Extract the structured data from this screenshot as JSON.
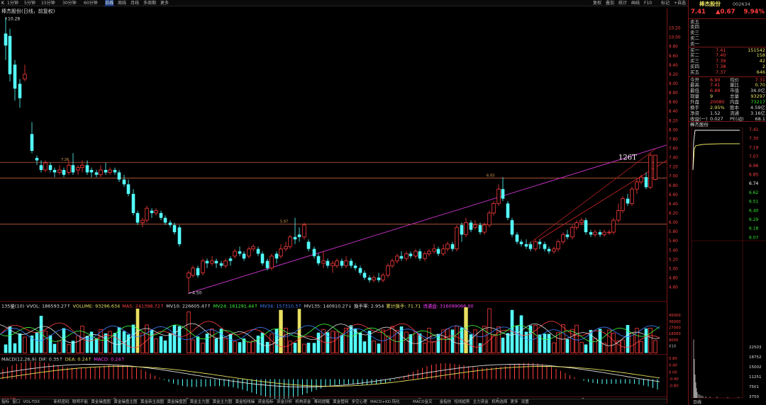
{
  "window": {
    "logo": "K"
  },
  "toolbar": {
    "periods": [
      "1分钟",
      "5分钟",
      "15分钟",
      "30分钟",
      "60分钟",
      "日线",
      "周线",
      "月线",
      "多周期",
      "更多"
    ],
    "active_period": "日线",
    "right_tools": [
      "复权",
      "叠加",
      "统计",
      "画线",
      "F10",
      "标记",
      "+自选",
      "返回"
    ]
  },
  "chart": {
    "title": "棒杰股份(日线，前复权)",
    "high_marker": "↑10.28",
    "low_marker": "←4.50",
    "annotation_126t": "126T",
    "level_labels": [
      "7.26",
      "6.93",
      "5.97"
    ],
    "y_labels": [
      "10.20",
      "10.00",
      "9.80",
      "9.60",
      "9.40",
      "9.20",
      "9.00",
      "8.80",
      "8.60",
      "8.40",
      "8.20",
      "8.00",
      "7.80",
      "7.60",
      "7.40",
      "7.20",
      "7.00",
      "6.80",
      "6.60",
      "6.40",
      "6.20",
      "6.00",
      "5.80",
      "5.60",
      "5.40",
      "5.20",
      "5.00",
      "4.80",
      "4.60"
    ],
    "x_labels": [
      "2019年",
      "2",
      "3",
      "4",
      "5",
      "6",
      "7"
    ],
    "vol_axis": [
      "45000",
      "36000",
      "27000",
      "18000",
      "9000",
      "X10"
    ],
    "macd_axis": [
      "0.80",
      "0.40",
      "0.00",
      "-0.40",
      "-0.80"
    ],
    "indicator_line": [
      {
        "text": "135量(10)",
        "color": "#dddddd"
      },
      {
        "text": "VVOL: 186593.27↑",
        "color": "#dddddd"
      },
      {
        "text": "VOLUME: 93296.634",
        "color": "#e8e060"
      },
      {
        "text": "MA5: 241398.72↑",
        "color": "#ff4040"
      },
      {
        "text": "MV10: 226605.47↑",
        "color": "#dddddd"
      },
      {
        "text": "MV24: 161291.44↑",
        "color": "#40ff40"
      },
      {
        "text": "MV34: 157310.3↑",
        "color": "#4080ff"
      },
      {
        "text": "MV135: 140910.27↓",
        "color": "#dddddd"
      },
      {
        "text": "换手率: 2.954",
        "color": "#dddddd"
      },
      {
        "text": "累计换手: 71.71",
        "color": "#e8e060"
      },
      {
        "text": "流通盘: 316099066.00",
        "color": "#ff40ff"
      }
    ],
    "macd_line": [
      {
        "text": "MACD(12,26,9)",
        "color": "#dddddd"
      },
      {
        "text": "DIF: 0.35↑",
        "color": "#dddddd"
      },
      {
        "text": "DEA: 0.24↑",
        "color": "#e8e060"
      },
      {
        "text": "MACD: 0.24↑",
        "color": "#ff40ff"
      }
    ]
  },
  "quote": {
    "name": "棒杰股份",
    "code": "002634",
    "price": "7.41",
    "change": "▲0.67",
    "pct": "9.94%",
    "asks": [
      {
        "label": "卖五",
        "price": "",
        "vol": ""
      },
      {
        "label": "卖四",
        "price": "",
        "vol": ""
      },
      {
        "label": "卖三",
        "price": "",
        "vol": ""
      },
      {
        "label": "卖二",
        "price": "",
        "vol": ""
      },
      {
        "label": "卖一",
        "price": "",
        "vol": ""
      }
    ],
    "bids": [
      {
        "label": "买一",
        "price": "7.41",
        "vol": "151542"
      },
      {
        "label": "买二",
        "price": "7.40",
        "vol": "158"
      },
      {
        "label": "买三",
        "price": "7.39",
        "vol": "42"
      },
      {
        "label": "买四",
        "price": "7.38",
        "vol": "2"
      },
      {
        "label": "买五",
        "price": "7.37",
        "vol": "646"
      }
    ],
    "stats": [
      {
        "l1": "今开",
        "v1": "6.90",
        "c1": "red",
        "l2": "均价",
        "v2": "7.31",
        "c2": "red"
      },
      {
        "l1": "最高",
        "v1": "7.41",
        "c1": "red",
        "l2": "量比",
        "v2": "0.70",
        "c2": "yel"
      },
      {
        "l1": "最低",
        "v1": "6.88",
        "c1": "red",
        "l2": "市值",
        "v2": "34.0亿",
        "c2": "wht"
      },
      {
        "l1": "现量",
        "v1": "9",
        "c1": "yel",
        "l2": "总量",
        "v2": "93297",
        "c2": "yel"
      },
      {
        "l1": "外盘",
        "v1": "20080",
        "c1": "red",
        "l2": "内盘",
        "v2": "73217",
        "c2": "grn"
      },
      {
        "l1": "换手",
        "v1": "2.95%",
        "c1": "yel",
        "l2": "股本",
        "v2": "4.59亿",
        "c2": "wht"
      },
      {
        "l1": "净资",
        "v1": "1.52",
        "c1": "wht",
        "l2": "流通",
        "v2": "3.16亿",
        "c2": "wht"
      },
      {
        "l1": "收益(一)",
        "v1": "0.027",
        "c1": "wht",
        "l2": "PE(动)",
        "v2": "68.1",
        "c2": "wht"
      }
    ],
    "mini_title": "棒杰股份",
    "mini_right": [
      "7.41",
      "7.30",
      "7.19",
      "7.07",
      "6.96",
      "6.85",
      "6.74",
      "6.62",
      "6.51",
      "6.40",
      "6.29",
      "6.18",
      "6.07"
    ],
    "mini_vol": [
      "22503",
      "18752",
      "15002",
      "11251",
      "7501",
      "3750"
    ],
    "mini_bottom": "日线"
  },
  "bottom_tabs": [
    "指标",
    "窗口",
    "VOL-TDX",
    "新机密码",
    "聪明不能",
    "黄金操盘图",
    "黄金操盘主图",
    "黄金新主战图",
    "黄金操盘团",
    "黄金主力图",
    "黄金主力图",
    "黄金短线操",
    "资金指标",
    "资金分析",
    "机构资金",
    "筹码提醒",
    "黄金管网",
    "多空心理",
    "MACD+KD.钝化",
    "MACD金叉",
    "金指信",
    "短线趋势",
    "主力资金",
    "机构选择",
    "更多",
    "设置"
  ],
  "colors": {
    "up": "#ff3c3c",
    "down": "#54ffff",
    "axis": "#7a1515",
    "ma_line": "#c03060"
  }
}
